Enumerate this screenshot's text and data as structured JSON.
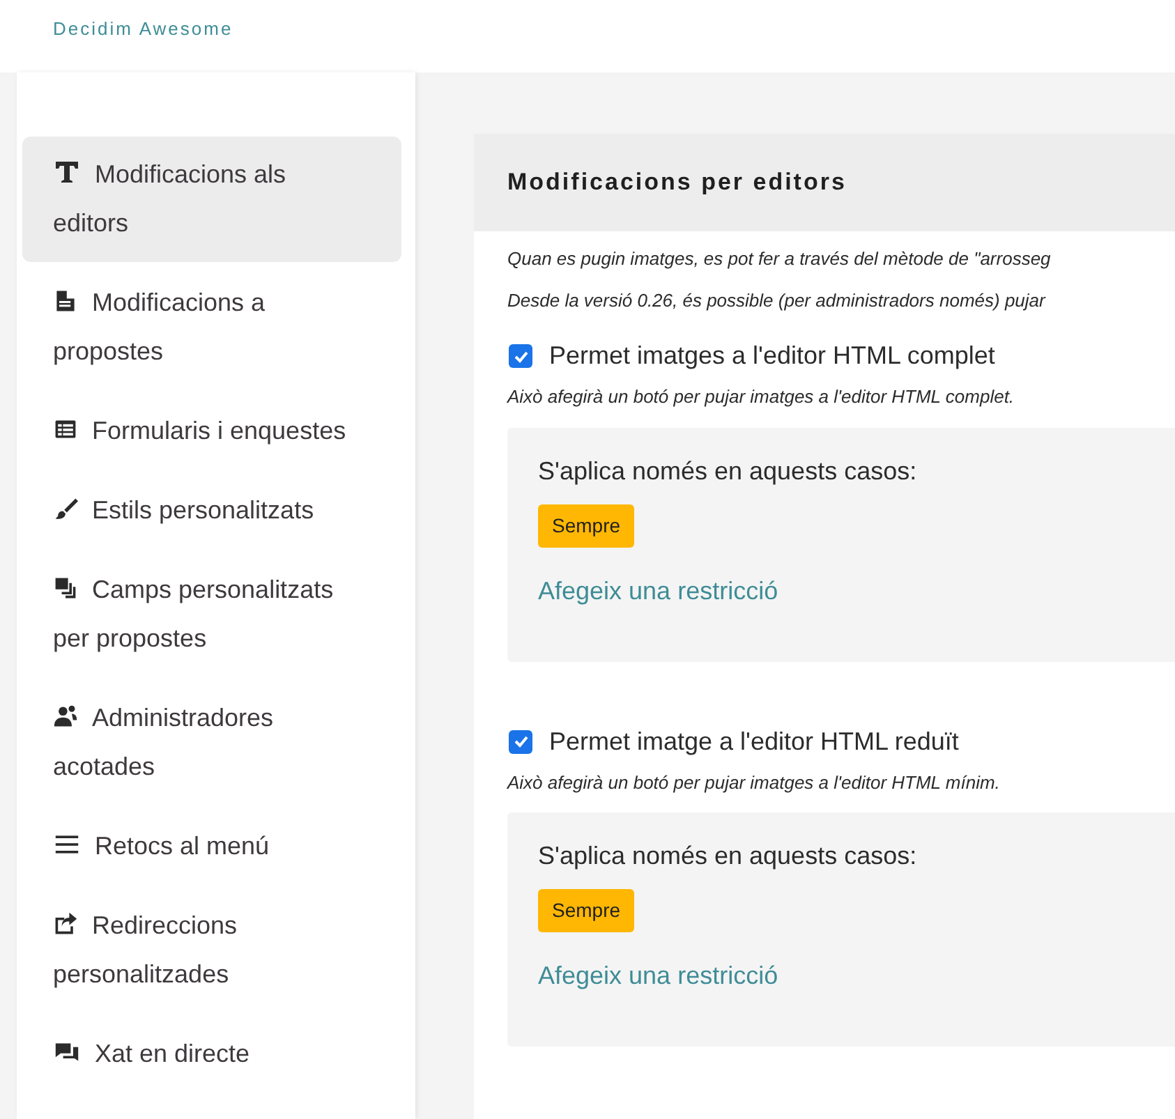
{
  "header": {
    "title": "Decidim Awesome"
  },
  "sidebar": {
    "items": [
      {
        "label": "Modificacions als editors",
        "selected": true
      },
      {
        "label": "Modificacions a propostes",
        "selected": false
      },
      {
        "label": "Formularis i enquestes",
        "selected": false
      },
      {
        "label": "Estils personalitzats",
        "selected": false
      },
      {
        "label": "Camps personalitzats per propostes",
        "selected": false
      },
      {
        "label": "Administradores acotades",
        "selected": false
      },
      {
        "label": "Retocs al menú",
        "selected": false
      },
      {
        "label": "Redireccions personalitzades",
        "selected": false
      },
      {
        "label": "Xat en directe",
        "selected": false
      }
    ]
  },
  "card": {
    "title": "Modificacions per editors",
    "notes": [
      "Quan es pugin imatges, es pot fer a través del mètode de \"arrosseg",
      "Desde la versió 0.26, és possible (per administradors només) pujar"
    ],
    "options": [
      {
        "label": "Permet imatges a l'editor HTML complet",
        "checked": true,
        "help": "Això afegirà un botó per pujar imatges a l'editor HTML complet.",
        "constraints": {
          "title": "S'aplica només en aquests casos:",
          "badge": "Sempre",
          "link": "Afegeix una restricció"
        }
      },
      {
        "label": "Permet imatge a l'editor HTML reduït",
        "checked": true,
        "help": "Això afegirà un botó per pujar imatges a l'editor HTML mínim.",
        "constraints": {
          "title": "S'aplica només en aquests casos:",
          "badge": "Sempre",
          "link": "Afegeix una restricció"
        }
      }
    ]
  }
}
